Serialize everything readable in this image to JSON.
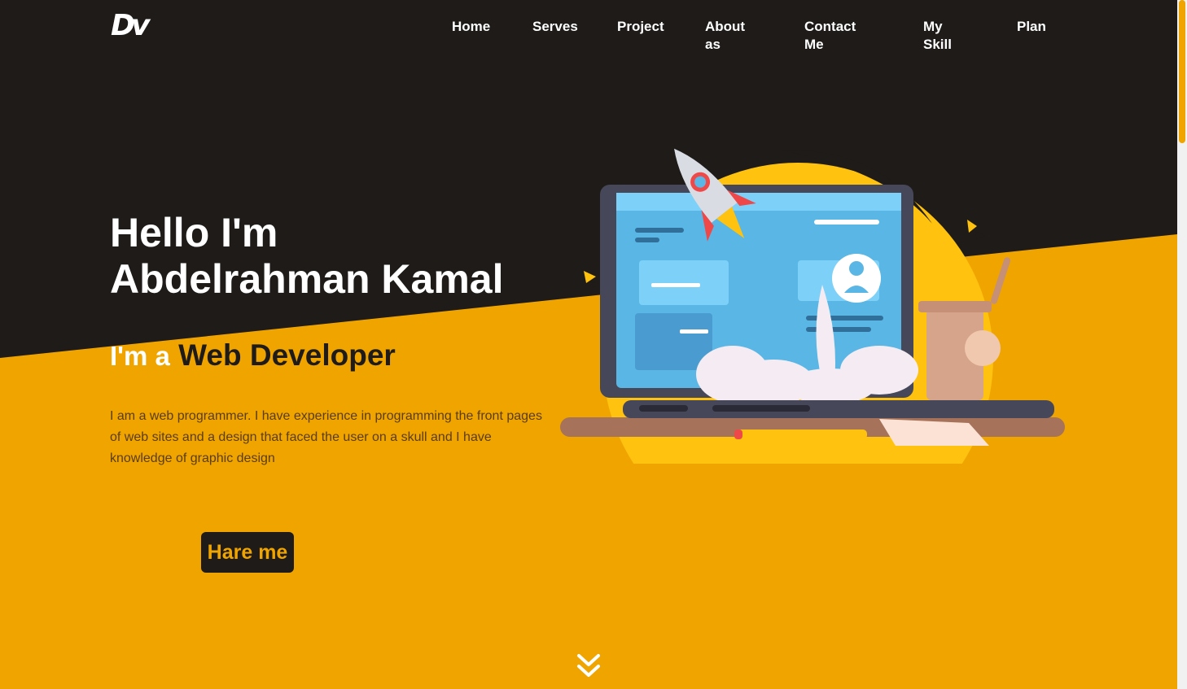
{
  "header": {
    "logo": "Dv",
    "nav": [
      "Home",
      "Serves",
      "Project",
      "About as",
      "Contact Me",
      "My Skill",
      "Plan"
    ]
  },
  "hero": {
    "greeting": "Hello I'm",
    "name": "Abdelrahman Kamal",
    "role_prefix": "I'm a",
    "role": "Web Developer",
    "description": "I am a web programmer. I have experience in programming the front pages of web sites and a design that faced the user on a skull and I have knowledge of graphic design",
    "cta_label": "Hare me"
  },
  "icons": {
    "scroll_down": "double-chevron-down-icon",
    "illustration": "rocket-laptop-illustration"
  },
  "colors": {
    "dark": "#1e1b19",
    "accent": "#f0a400",
    "light_accent": "#ffc20e"
  }
}
